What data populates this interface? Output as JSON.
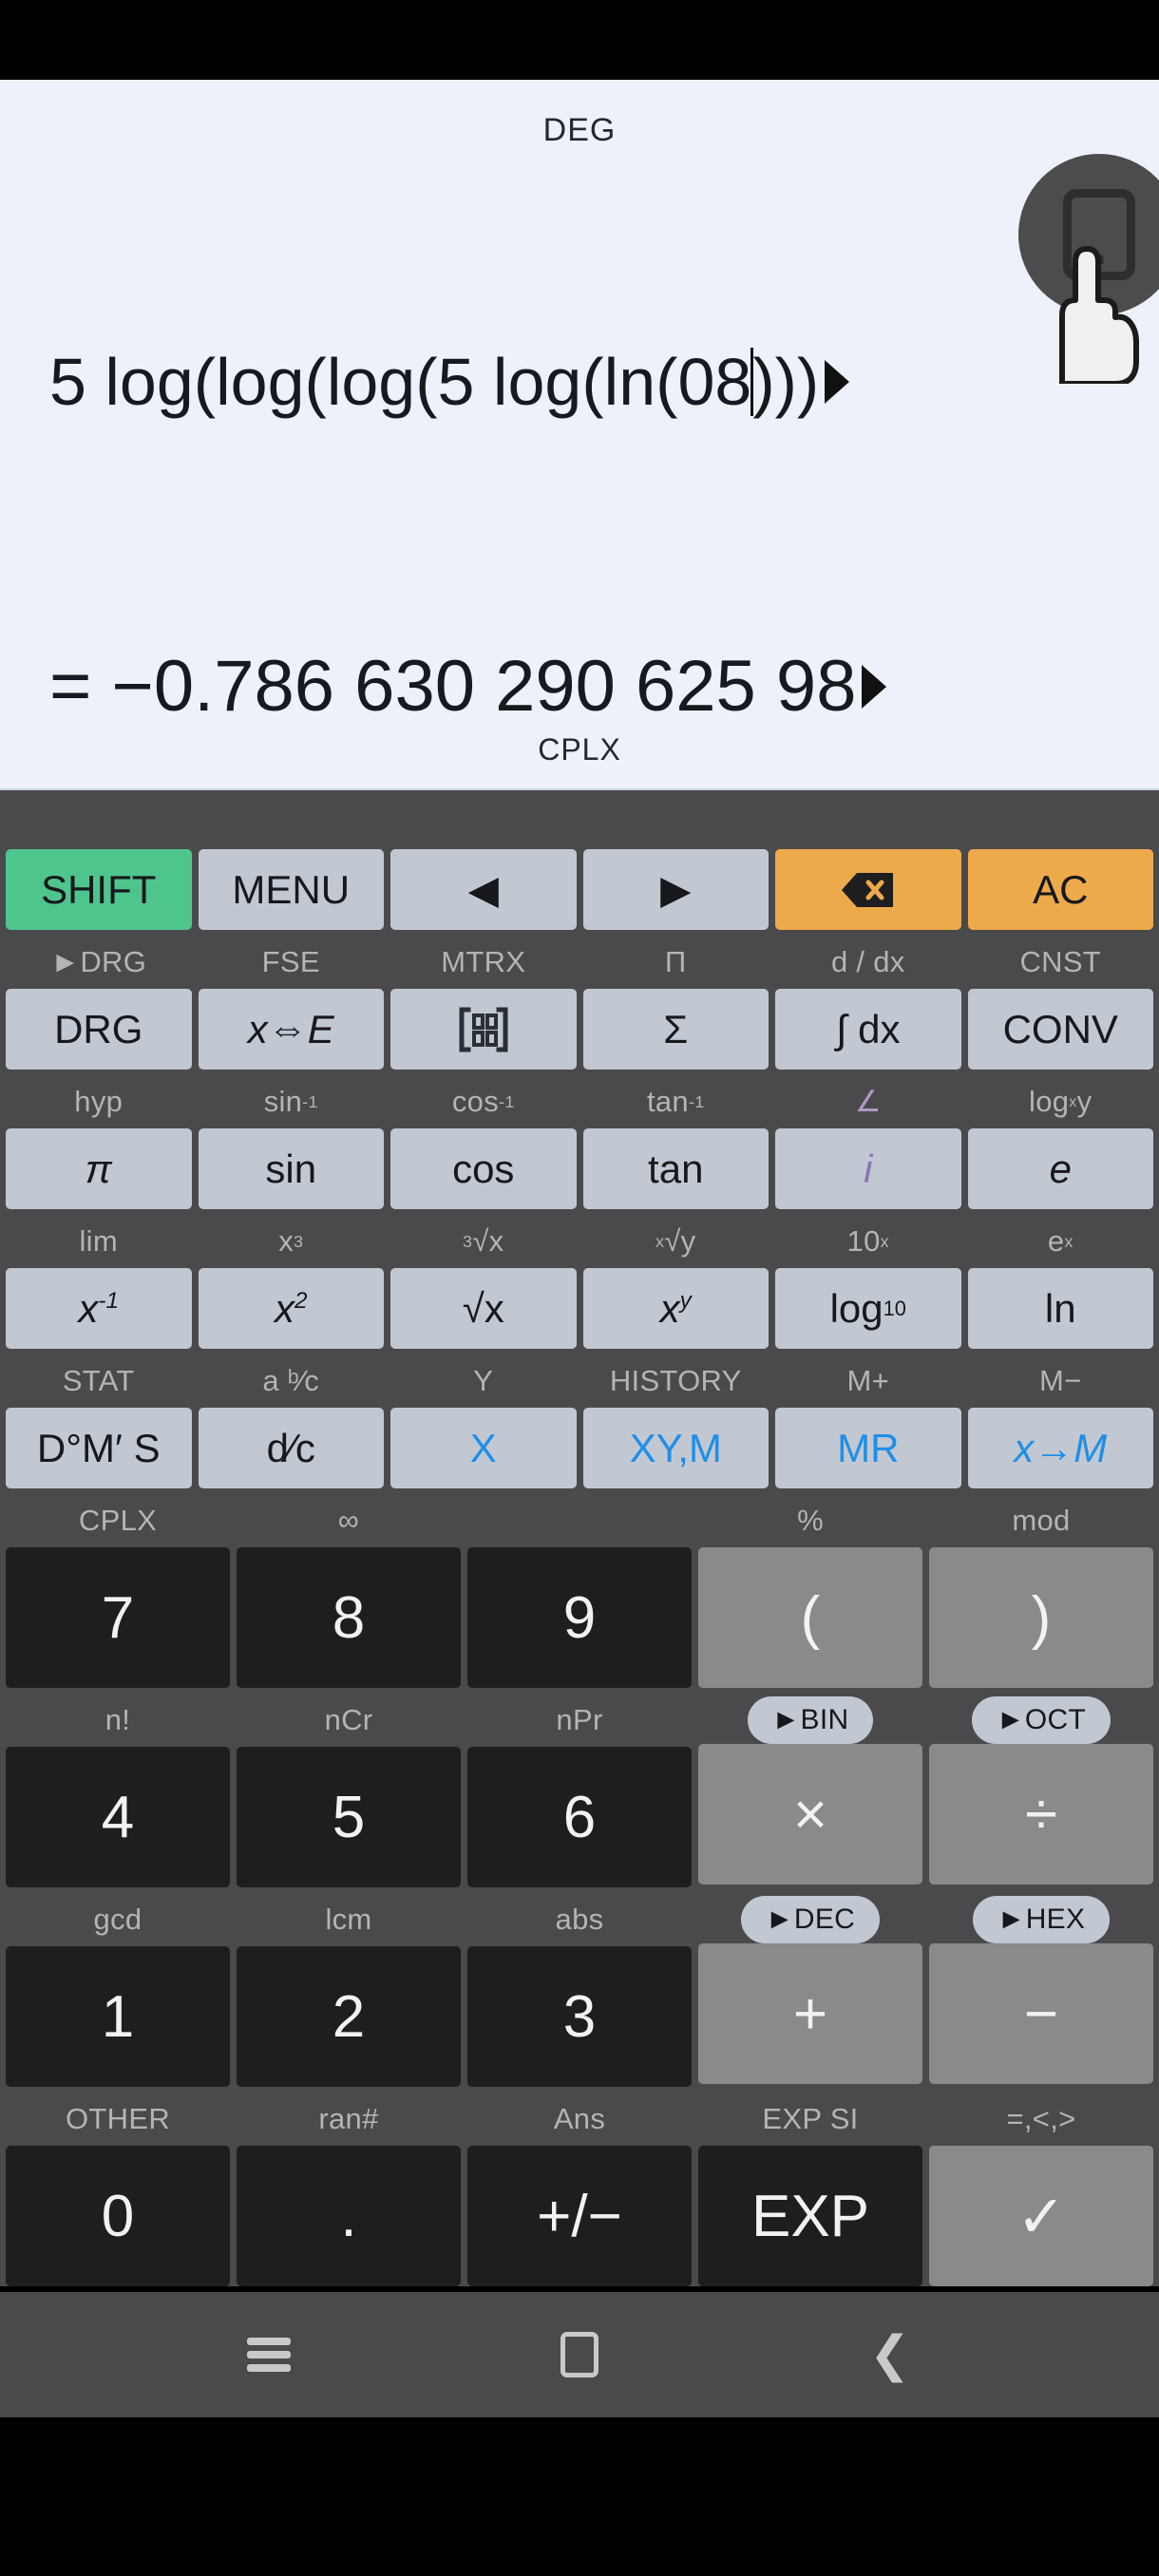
{
  "display": {
    "mode_top": "DEG",
    "mode_bottom": "CPLX",
    "expression_before_caret": "5 log(log(log(5 log(ln(08",
    "expression_after_caret": ")))",
    "expression_full": "5 log(log(log(5 log(ln(08))))",
    "result": "= −0.786 630 290 625 98",
    "result_overflow_arrow": "▶",
    "expression_overflow_arrow": "▶"
  },
  "keypad": {
    "rows": [
      {
        "id": "row-function-1",
        "labels": [
          "",
          "",
          "",
          "",
          "",
          ""
        ],
        "keys": [
          {
            "name": "shift",
            "label": "SHIFT",
            "style": "b-green"
          },
          {
            "name": "menu",
            "label": "MENU",
            "style": "b-grey"
          },
          {
            "name": "cursor-left",
            "label": "◀",
            "style": "b-grey"
          },
          {
            "name": "cursor-right",
            "label": "▶",
            "style": "b-grey"
          },
          {
            "name": "backspace",
            "label": "⌫",
            "style": "b-orange"
          },
          {
            "name": "all-clear",
            "label": "AC",
            "style": "b-orange"
          }
        ]
      },
      {
        "id": "row-function-2",
        "labels": [
          "►DRG",
          "FSE",
          "MTRX",
          "Π",
          "d / dx",
          "CNST"
        ],
        "keys": [
          {
            "name": "drg",
            "label": "DRG",
            "style": "b-grey"
          },
          {
            "name": "x-to-e",
            "label": "x⇔E",
            "style": "b-grey"
          },
          {
            "name": "matrix",
            "label": "[matrix]",
            "style": "b-grey"
          },
          {
            "name": "sigma",
            "label": "Σ",
            "style": "b-grey"
          },
          {
            "name": "integral",
            "label": "∫ dx",
            "style": "b-grey"
          },
          {
            "name": "convert",
            "label": "CONV",
            "style": "b-grey"
          }
        ]
      },
      {
        "id": "row-trig",
        "labels": [
          "hyp",
          "sin⁻¹",
          "cos⁻¹",
          "tan⁻¹",
          "∠",
          "logₓ y"
        ],
        "keys": [
          {
            "name": "pi",
            "label": "π",
            "style": "b-grey"
          },
          {
            "name": "sin",
            "label": "sin",
            "style": "b-grey"
          },
          {
            "name": "cos",
            "label": "cos",
            "style": "b-grey"
          },
          {
            "name": "tan",
            "label": "tan",
            "style": "b-grey"
          },
          {
            "name": "imaginary-unit",
            "label": "i",
            "style": "b-grey"
          },
          {
            "name": "euler-e",
            "label": "e",
            "style": "b-grey"
          }
        ]
      },
      {
        "id": "row-power",
        "labels": [
          "lim",
          "x³",
          "³√x",
          "ˣ√y",
          "10ˣ",
          "eˣ"
        ],
        "keys": [
          {
            "name": "reciprocal",
            "label": "x⁻¹",
            "style": "b-grey"
          },
          {
            "name": "square",
            "label": "x²",
            "style": "b-grey"
          },
          {
            "name": "square-root",
            "label": "√x",
            "style": "b-grey"
          },
          {
            "name": "power",
            "label": "xʸ",
            "style": "b-grey"
          },
          {
            "name": "log-base-10",
            "label": "log₁₀",
            "style": "b-grey"
          },
          {
            "name": "natural-log",
            "label": "ln",
            "style": "b-grey"
          }
        ]
      },
      {
        "id": "row-memory",
        "labels": [
          "STAT",
          "a ᵇ⁄c",
          "Y",
          "HISTORY",
          "M+",
          "M−"
        ],
        "keys": [
          {
            "name": "degrees-minutes-seconds",
            "label": "D°M′ S",
            "style": "b-grey"
          },
          {
            "name": "fraction-dc",
            "label": "d⁄c",
            "style": "b-grey"
          },
          {
            "name": "variable-x",
            "label": "X",
            "style": "b-blue"
          },
          {
            "name": "variable-xym",
            "label": "XY,M",
            "style": "b-blue"
          },
          {
            "name": "memory-recall",
            "label": "MR",
            "style": "b-blue"
          },
          {
            "name": "store-to-memory",
            "label": "x→M",
            "style": "b-blue"
          }
        ]
      },
      {
        "id": "row-789",
        "labels": [
          "CPLX",
          "∞",
          "",
          "%",
          "mod"
        ],
        "pills": [
          false,
          false,
          false,
          false,
          false
        ],
        "keys": [
          {
            "name": "digit-7",
            "label": "7",
            "style": "b-dark"
          },
          {
            "name": "digit-8",
            "label": "8",
            "style": "b-dark"
          },
          {
            "name": "digit-9",
            "label": "9",
            "style": "b-dark"
          },
          {
            "name": "paren-open",
            "label": "(",
            "style": "b-mid"
          },
          {
            "name": "paren-close",
            "label": ")",
            "style": "b-mid"
          }
        ]
      },
      {
        "id": "row-456",
        "labels": [
          "n!",
          "nCr",
          "nPr",
          "►BIN",
          "►OCT"
        ],
        "pills": [
          false,
          false,
          false,
          true,
          true
        ],
        "keys": [
          {
            "name": "digit-4",
            "label": "4",
            "style": "b-dark"
          },
          {
            "name": "digit-5",
            "label": "5",
            "style": "b-dark"
          },
          {
            "name": "digit-6",
            "label": "6",
            "style": "b-dark"
          },
          {
            "name": "multiply",
            "label": "×",
            "style": "b-mid"
          },
          {
            "name": "divide",
            "label": "÷",
            "style": "b-mid"
          }
        ]
      },
      {
        "id": "row-123",
        "labels": [
          "gcd",
          "lcm",
          "abs",
          "►DEC",
          "►HEX"
        ],
        "pills": [
          false,
          false,
          false,
          true,
          true
        ],
        "keys": [
          {
            "name": "digit-1",
            "label": "1",
            "style": "b-dark"
          },
          {
            "name": "digit-2",
            "label": "2",
            "style": "b-dark"
          },
          {
            "name": "digit-3",
            "label": "3",
            "style": "b-dark"
          },
          {
            "name": "plus",
            "label": "+",
            "style": "b-mid"
          },
          {
            "name": "minus",
            "label": "−",
            "style": "b-mid"
          }
        ]
      },
      {
        "id": "row-zero",
        "labels": [
          "OTHER",
          "ran#",
          "Ans",
          "EXP SI",
          "=,<,>"
        ],
        "pills": [
          false,
          false,
          false,
          false,
          false
        ],
        "keys": [
          {
            "name": "digit-0",
            "label": "0",
            "style": "b-dark"
          },
          {
            "name": "decimal-point",
            "label": ".",
            "style": "b-dark"
          },
          {
            "name": "sign-toggle",
            "label": "+/−",
            "style": "b-dark"
          },
          {
            "name": "exponent",
            "label": "EXP",
            "style": "b-dark"
          },
          {
            "name": "equals",
            "label": "✓",
            "style": "b-mid"
          }
        ]
      }
    ]
  },
  "navbar": {
    "recents": "recents-icon",
    "home": "home-icon",
    "back": "back-icon"
  },
  "overlay": {
    "badge": "phone-screen-icon",
    "cursor": "pointing-hand-cursor"
  },
  "colors": {
    "display_bg": "#edf1f9",
    "keypad_bg": "#4a4a4d",
    "shift_green": "#4fc58e",
    "clear_orange": "#edaa4a",
    "key_grey": "#c2c8d2",
    "key_dark": "#1e1e20",
    "key_mid": "#8a8a8d",
    "memory_blue": "#1e8fe8",
    "label_grey": "#b4b4b4",
    "label_purple": "#b09ac8"
  }
}
